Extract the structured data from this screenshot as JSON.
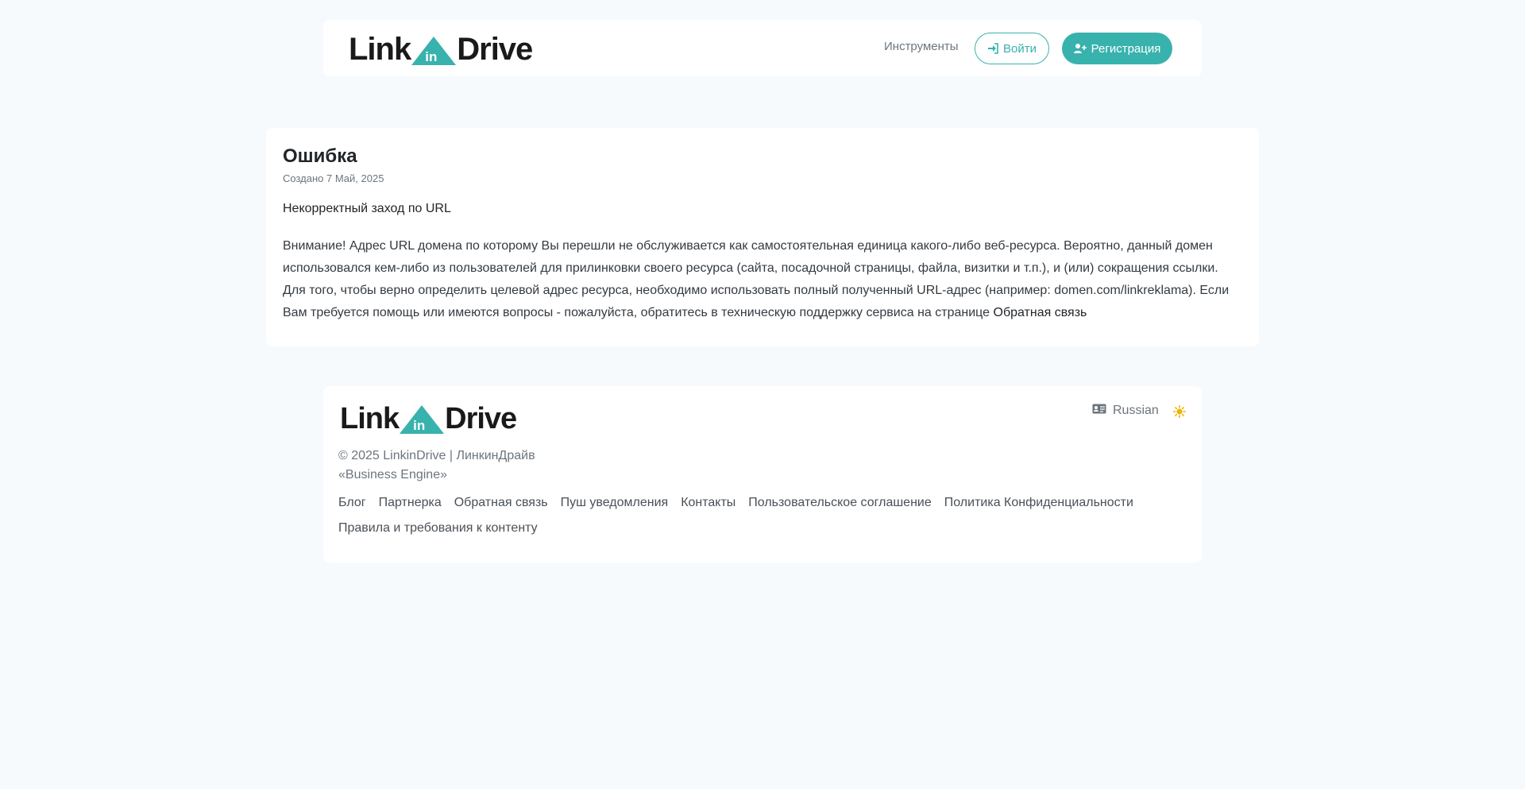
{
  "header": {
    "logo_left": "Link",
    "logo_in": "in",
    "logo_right": "Drive",
    "nav_tools": "Инструменты",
    "login_label": "Войти",
    "register_label": "Регистрация"
  },
  "article": {
    "title": "Ошибка",
    "created": "Создано 7 Май, 2025",
    "lead": "Некорректный заход по URL",
    "paragraph": "Внимание! Адрес URL домена по которому Вы перешли не обслуживается как самостоятельная единица какого-либо веб-ресурса. Вероятно, данный домен использовался кем-либо из пользователей для прилинковки своего ресурса (сайта, посадочной страницы, файла, визитки и т.п.), и (или) сокращения ссылки. Для того, чтобы верно определить целевой адрес ресурса, необходимо использовать полный полученный URL-адрес (например: domen.com/linkreklama). Если Вам требуется помощь или имеются вопросы - пожалуйста, обратитесь в техническую поддержку сервиса на странице",
    "feedback_link": "Обратная связь"
  },
  "footer": {
    "copyright_line1": "© 2025 LinkinDrive | ЛинкинДрайв",
    "copyright_line2": "«Business Engine»",
    "language": "Russian",
    "links_row1": [
      "Блог",
      "Партнерка",
      "Обратная связь",
      "Пуш уведомления",
      "Контакты",
      "Пользовательское соглашение",
      "Политика Конфиденциальности"
    ],
    "links_row2": [
      "Правила и требования к контенту"
    ]
  },
  "colors": {
    "accent": "#38b2ac",
    "background": "#f6fafd",
    "sun": "#f0b400"
  },
  "icons": {
    "login": "sign-in-icon",
    "register": "user-plus-icon",
    "language": "id-card-icon",
    "theme": "sun-icon"
  }
}
